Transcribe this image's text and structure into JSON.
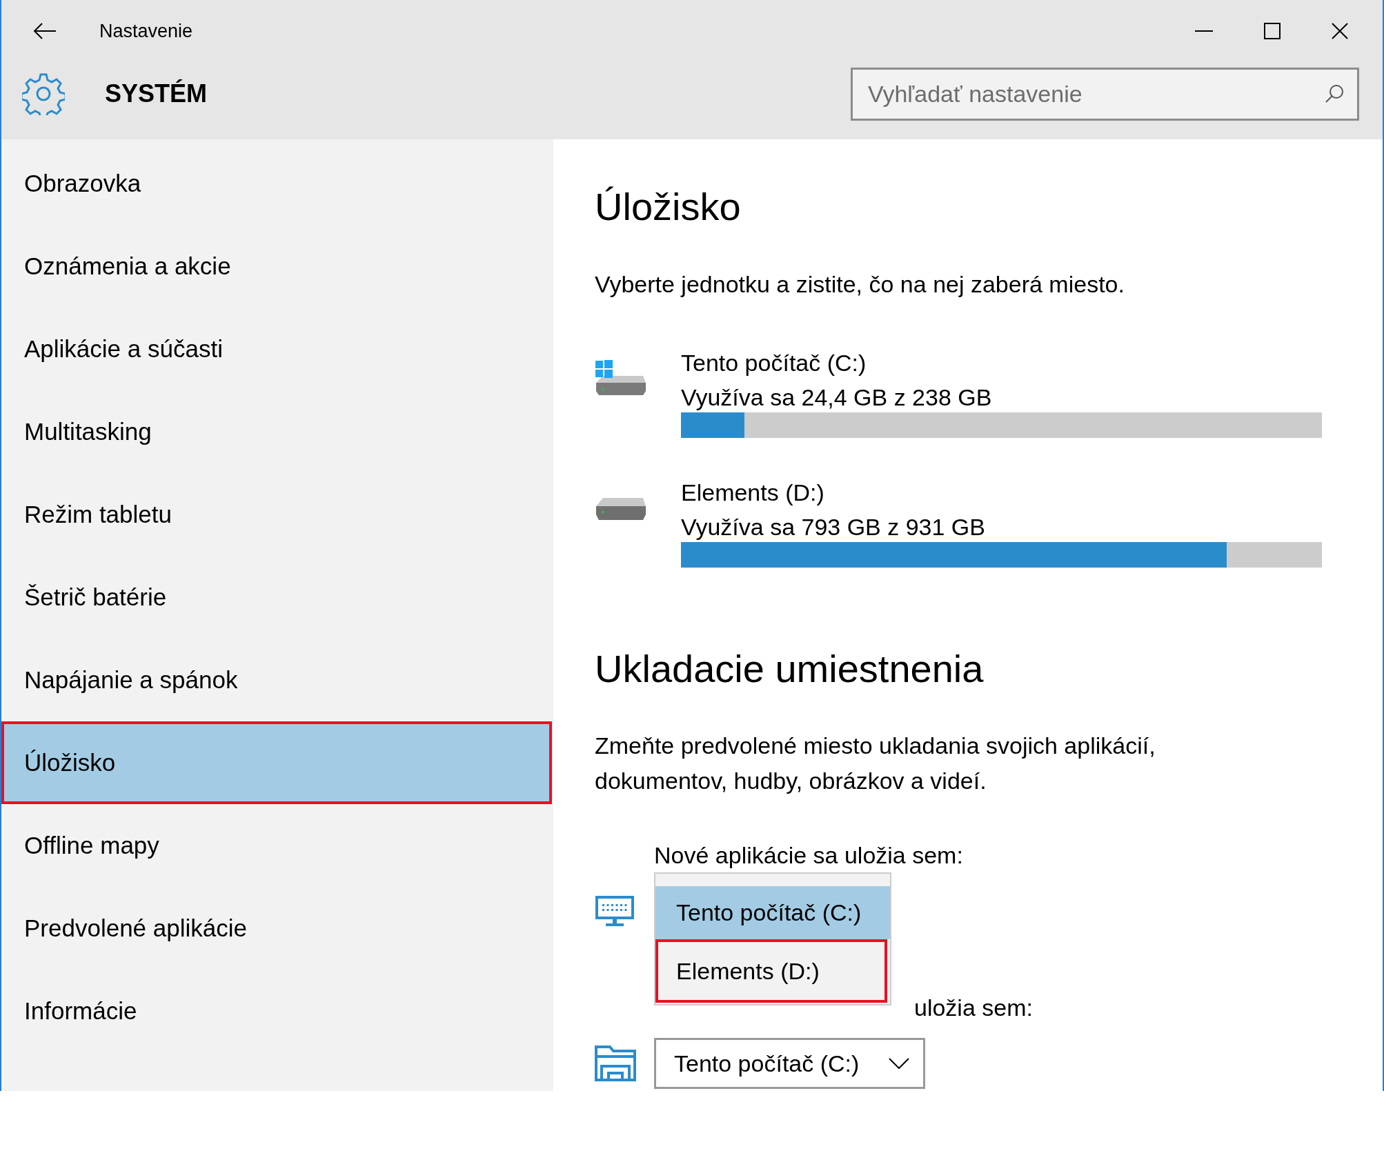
{
  "window": {
    "title": "Nastavenie"
  },
  "header": {
    "title": "SYSTÉM",
    "search": {
      "placeholder": "Vyhľadať nastavenie"
    }
  },
  "sidebar": {
    "items": [
      {
        "label": "Obrazovka",
        "selected": false,
        "highlighted": false
      },
      {
        "label": "Oznámenia a akcie",
        "selected": false,
        "highlighted": false
      },
      {
        "label": "Aplikácie a súčasti",
        "selected": false,
        "highlighted": false
      },
      {
        "label": "Multitasking",
        "selected": false,
        "highlighted": false
      },
      {
        "label": "Režim tabletu",
        "selected": false,
        "highlighted": false
      },
      {
        "label": "Šetrič batérie",
        "selected": false,
        "highlighted": false
      },
      {
        "label": "Napájanie a spánok",
        "selected": false,
        "highlighted": false
      },
      {
        "label": "Úložisko",
        "selected": true,
        "highlighted": true
      },
      {
        "label": "Offline mapy",
        "selected": false,
        "highlighted": false
      },
      {
        "label": "Predvolené aplikácie",
        "selected": false,
        "highlighted": false
      },
      {
        "label": "Informácie",
        "selected": false,
        "highlighted": false
      }
    ]
  },
  "storage": {
    "title": "Úložisko",
    "description": "Vyberte jednotku a zistite, čo na nej zaberá miesto.",
    "drives": [
      {
        "name": "Tento počítač (C:)",
        "usage": "Využíva sa 24,4 GB z 238 GB",
        "kind": "system",
        "level": 0.099
      },
      {
        "name": "Elements (D:)",
        "usage": "Využíva sa 793 GB z 931 GB",
        "kind": "external",
        "level": 0.851
      }
    ]
  },
  "save_locations": {
    "title": "Ukladacie umiestnenia",
    "description": "Zmeňte predvolené miesto ukladania svojich aplikácií, dokumentov, hudby, obrázkov a videí.",
    "items": [
      {
        "label": "Nové aplikácie sa uložia sem:",
        "kind": "monitor",
        "open": true,
        "options": [
          {
            "label": "Tento počítač (C:)",
            "selected": true,
            "highlighted": false
          },
          {
            "label": "Elements (D:)",
            "selected": false,
            "highlighted": true
          }
        ]
      },
      {
        "label": "uložia sem:",
        "kind": "folder",
        "open": false,
        "value": "Tento počítač (C:)"
      }
    ]
  }
}
